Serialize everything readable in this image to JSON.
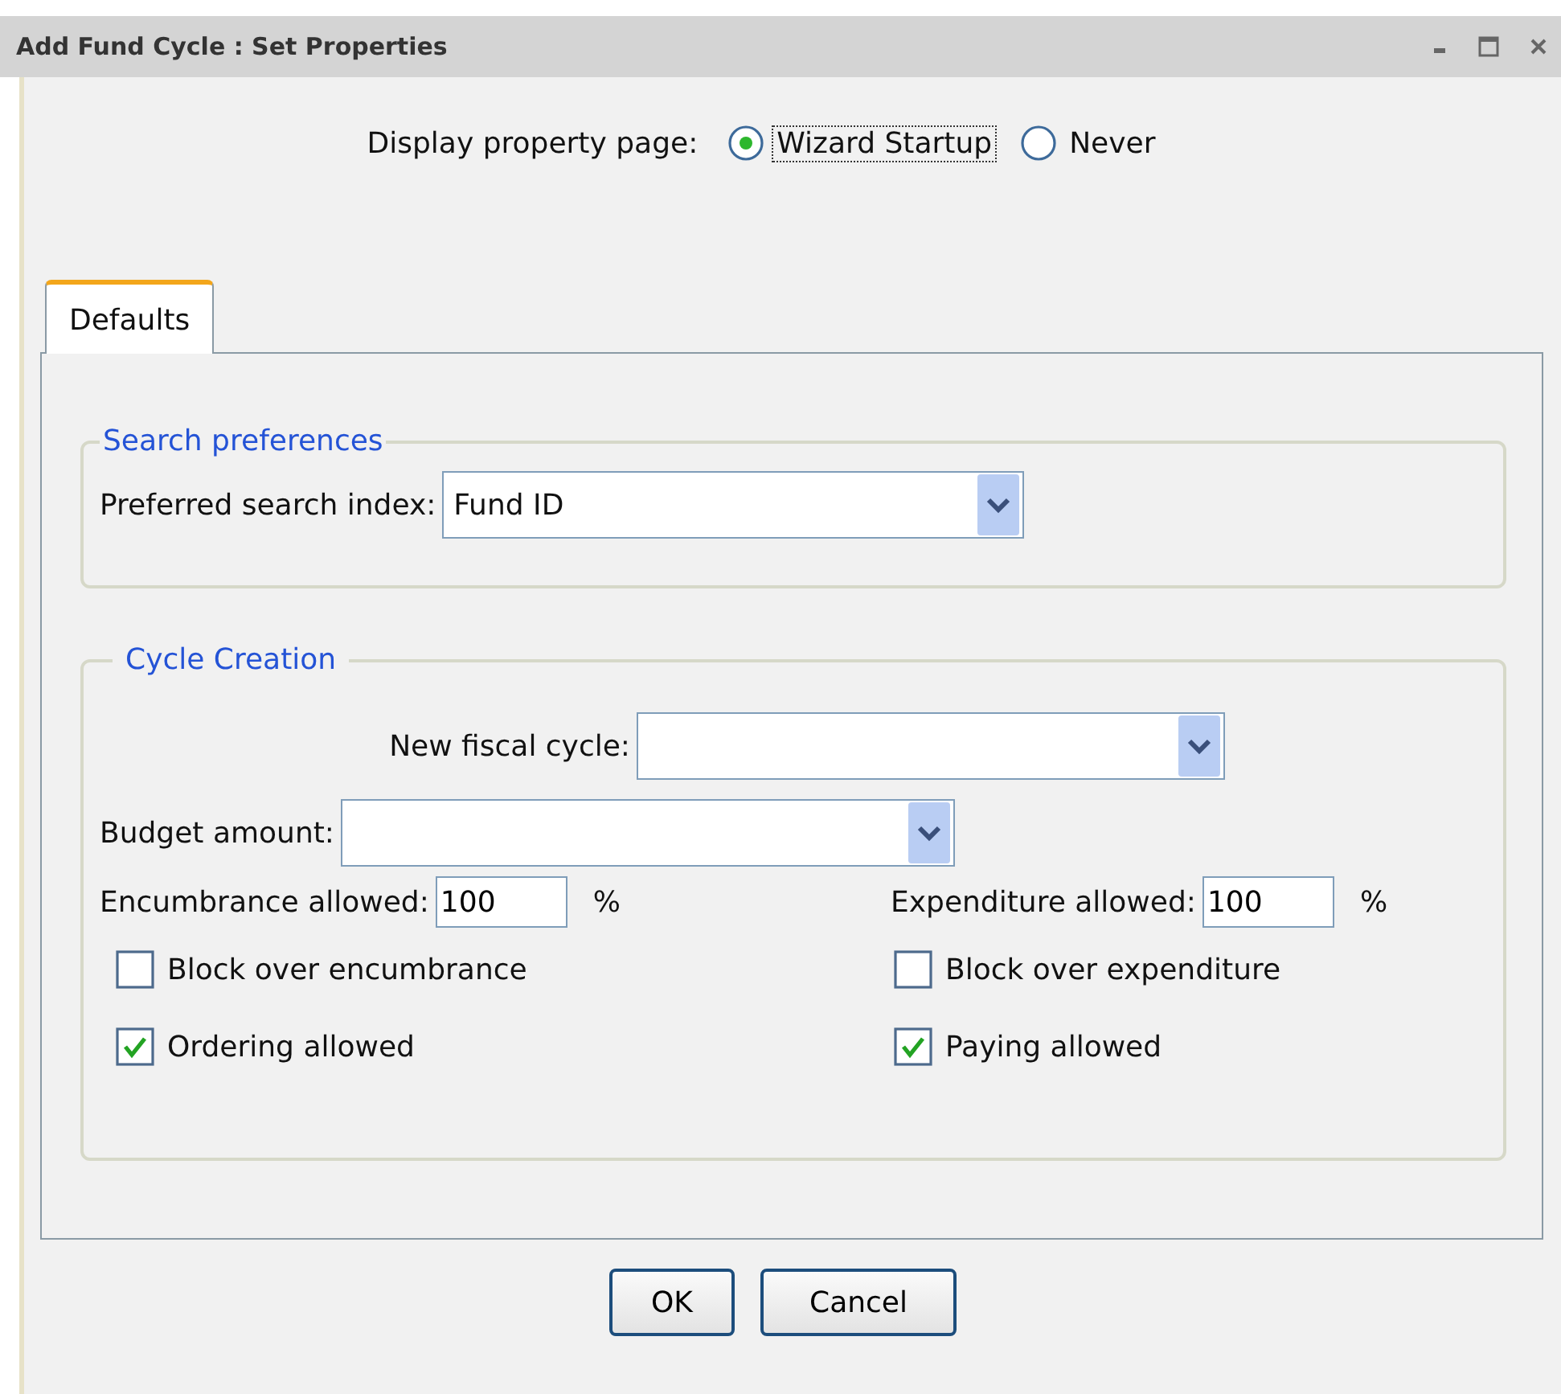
{
  "window": {
    "title": "Add Fund Cycle :  Set Properties"
  },
  "display_property": {
    "label": "Display property page:",
    "options": [
      {
        "label": "Wizard Startup",
        "selected": true,
        "focused": true
      },
      {
        "label": "Never",
        "selected": false,
        "focused": false
      }
    ]
  },
  "tabs": [
    {
      "label": "Defaults",
      "selected": true
    }
  ],
  "search_preferences": {
    "legend": "Search preferences",
    "field": {
      "label": "Preferred search index:",
      "value": "Fund ID"
    }
  },
  "cycle_creation": {
    "legend": "Cycle Creation",
    "new_fiscal_cycle": {
      "label": "New fiscal cycle:"
    },
    "budget_amount": {
      "label": "Budget amount:"
    },
    "allowances": [
      {
        "label": "Encumbrance allowed:",
        "value": "100",
        "unit": "%"
      },
      {
        "label": "Expenditure allowed:",
        "value": "100",
        "unit": "%"
      }
    ],
    "checkboxes": [
      {
        "label": "Block over encumbrance",
        "checked": false
      },
      {
        "label": "Block over expenditure",
        "checked": false
      },
      {
        "label": "Ordering allowed",
        "checked": true
      },
      {
        "label": "Paying allowed",
        "checked": true
      }
    ]
  },
  "buttons": [
    "OK",
    "Cancel"
  ]
}
